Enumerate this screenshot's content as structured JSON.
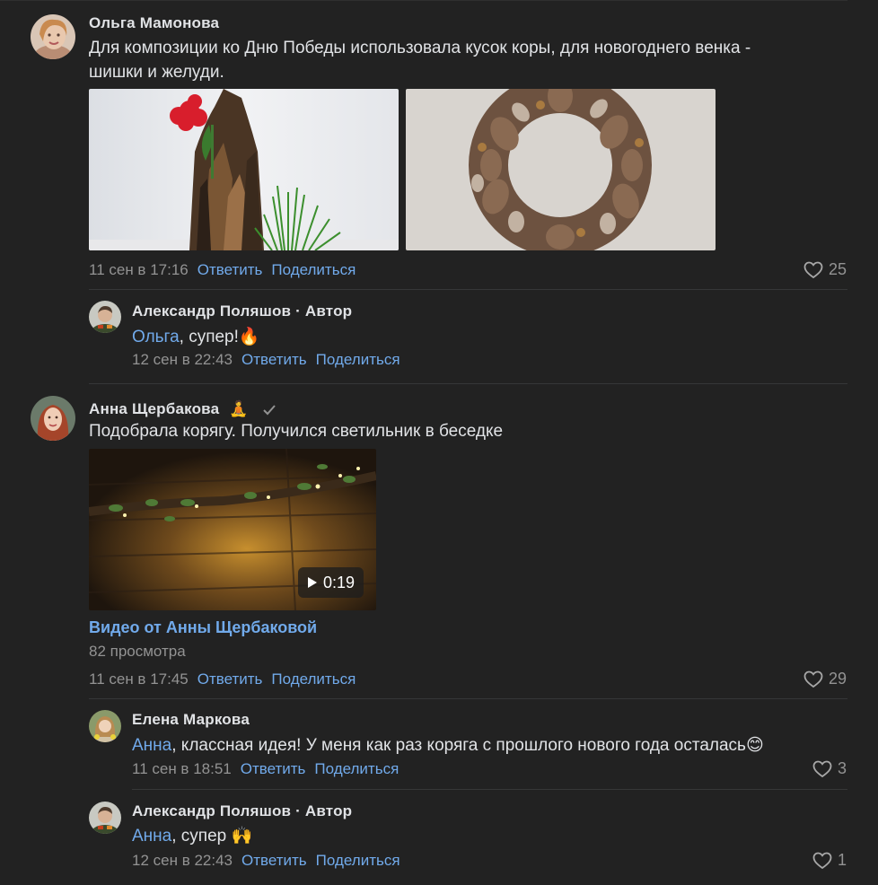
{
  "comments": [
    {
      "author": "Ольга Мамонова",
      "text_line1": "Для композиции ко Дню Победы использовала кусок коры, для новогоднего венка -",
      "text_line2": "шишки и желуди.",
      "date": "11 сен в 17:16",
      "reply": "Ответить",
      "share": "Поделиться",
      "likes": "25",
      "replies": [
        {
          "author": "Александр Поляшов · Автор",
          "mention": "Ольга",
          "text": ", супер!",
          "emoji": "🔥",
          "date": "12 сен в 22:43",
          "reply": "Ответить",
          "share": "Поделиться"
        }
      ]
    },
    {
      "author": "Анна Щербакова",
      "author_badge": "🧘",
      "text": "Подобрала корягу. Получился светильник в беседке",
      "video_duration": "0:19",
      "video_title": "Видео от Анны Щербаковой",
      "video_views": "82 просмотра",
      "date": "11 сен в 17:45",
      "reply": "Ответить",
      "share": "Поделиться",
      "likes": "29",
      "replies": [
        {
          "author": "Елена Маркова",
          "mention": "Анна",
          "text": ", классная идея! У меня как раз коряга с прошлого нового года осталась",
          "emoji": "😊",
          "date": "11 сен в 18:51",
          "reply": "Ответить",
          "share": "Поделиться",
          "likes": "3"
        },
        {
          "author": "Александр Поляшов · Автор",
          "mention": "Анна",
          "text": ", супер ",
          "emoji": "🙌",
          "date": "12 сен в 22:43",
          "reply": "Ответить",
          "share": "Поделиться",
          "likes": "1"
        }
      ]
    }
  ],
  "colors": {
    "background": "#222222",
    "link": "#71aaeb",
    "muted": "#939393",
    "text": "#e1e3e6"
  }
}
